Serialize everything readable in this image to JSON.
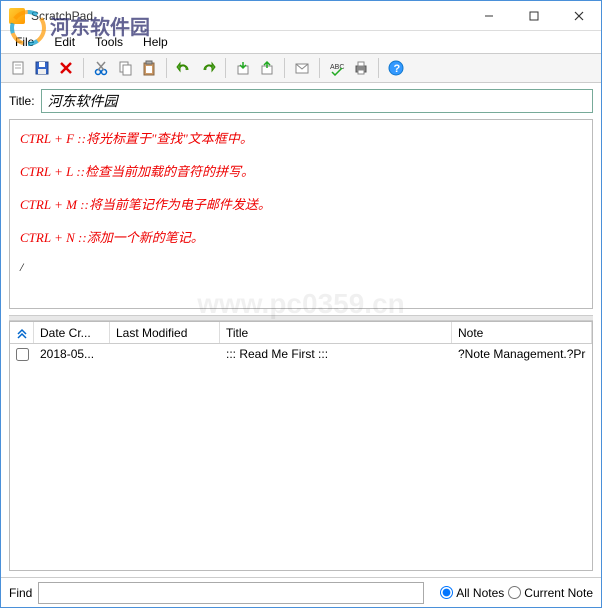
{
  "window": {
    "title": "ScratchPad"
  },
  "menubar": {
    "file": "File",
    "edit": "Edit",
    "tools": "Tools",
    "help": "Help"
  },
  "title_field": {
    "label": "Title:",
    "value": "河东软件园"
  },
  "editor": {
    "lines": [
      "CTRL + F ::将光标置于\"查找\"文本框中。",
      "CTRL + L ::检查当前加载的音符的拼写。",
      "CTRL + M ::将当前笔记作为电子邮件发送。",
      "CTRL + N ::添加一个新的笔记。"
    ],
    "caret": "/"
  },
  "list": {
    "headers": {
      "date": "Date Cr...",
      "modified": "Last Modified",
      "title": "Title",
      "note": "Note"
    },
    "rows": [
      {
        "date": "2018-05...",
        "modified": "",
        "title": "::: Read Me First :::",
        "note": "?Note Management.?Pr"
      }
    ]
  },
  "findbar": {
    "label": "Find",
    "value": "",
    "all_notes": "All Notes",
    "current_note": "Current Note"
  },
  "watermark": {
    "text": "www.pc0359.cn",
    "site": "河东软件园"
  }
}
